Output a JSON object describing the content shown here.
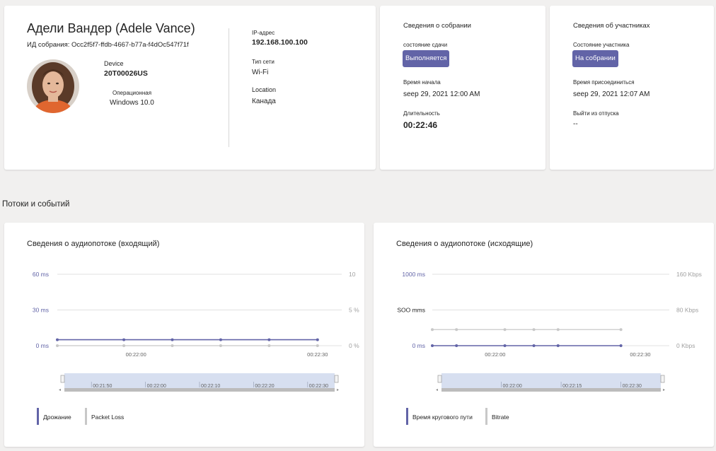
{
  "user": {
    "name": "Адели Вандер (Adele Vance)",
    "meeting_id": "ИД собрания: Occ2f5f7-ffdb-4667-b77a-f4dOc547f71f",
    "device_label": "Device",
    "device_value": "20T00026US",
    "os_label": "Операционная",
    "os_value": "Windows 10.0",
    "ip_label": "IP-адрес",
    "ip_value": "192.168.100.100",
    "network_label": "Тип сети",
    "network_value": "Wi-Fi",
    "location_label": "Location",
    "location_value": "Канада"
  },
  "meeting": {
    "title": "Сведения о собрании",
    "status_label": "состояние сдачи",
    "status_value": "Выполняется",
    "start_label": "Время начала",
    "start_value": "seep 29, 2021 12:00 AM",
    "duration_label": "Длительность",
    "duration_value": "00:22:46"
  },
  "participant": {
    "title": "Сведения об участниках",
    "status_label": "Состояние участника",
    "status_value": "На собрании",
    "join_label": "Время присоединиться",
    "join_value": "seep 29, 2021 12:07 AM",
    "leave_label": "Выйти из отпуска",
    "leave_value": "--"
  },
  "streams_title": "Потоки и событий",
  "colors": {
    "accent": "#6264a7",
    "secondary_series": "#c8c8c8",
    "range_fill": "#d7dff0"
  },
  "chart_data": [
    {
      "type": "line",
      "title": "Сведения о аудиопотоке (входящий)",
      "x": [
        "00:21:47",
        "00:21:58",
        "00:22:06",
        "00:22:14",
        "00:22:22",
        "00:22:30"
      ],
      "x_ticks": [
        "00:22:00",
        "00:22:30"
      ],
      "y_left_ticks": [
        "60 ms",
        "30 ms",
        "0 ms"
      ],
      "y_right_ticks": [
        "10",
        "5 %",
        "0 %"
      ],
      "ylim_left": [
        0,
        60
      ],
      "ylim_right": [
        0,
        10
      ],
      "series": [
        {
          "name": "Дрожание",
          "axis": "left",
          "values": [
            5,
            5,
            5,
            5,
            5,
            5
          ]
        },
        {
          "name": "Packet Loss",
          "axis": "right",
          "values": [
            0,
            0,
            0,
            0,
            0,
            0
          ]
        }
      ],
      "navigator_ticks": [
        "00:21:50",
        "00:22:00",
        "00:22:10",
        "00:22:20",
        "00:22:30"
      ],
      "grid": true,
      "legend": "bottom-left"
    },
    {
      "type": "line",
      "title": "Сведения о аудиопотоке (исходящие)",
      "x": [
        "00:21:47",
        "00:21:52",
        "00:22:02",
        "00:22:08",
        "00:22:13",
        "00:22:26"
      ],
      "x_ticks": [
        "00:22:00",
        "00:22:30"
      ],
      "y_left_ticks": [
        "1000 ms",
        "SOO mms",
        "0 ms"
      ],
      "y_right_ticks": [
        "160 Kbps",
        "80 Kbps",
        "0 Kbps"
      ],
      "ylim_left": [
        0,
        1000
      ],
      "ylim_right": [
        0,
        160
      ],
      "series": [
        {
          "name": "Время кругового пути",
          "axis": "left",
          "values": [
            0,
            0,
            0,
            0,
            0,
            0
          ]
        },
        {
          "name": "Bitrate",
          "axis": "right",
          "values": [
            36,
            36,
            36,
            36,
            36,
            36
          ]
        }
      ],
      "navigator_ticks": [
        "00:22:00",
        "00:22:15",
        "00:22:30"
      ],
      "grid": true,
      "legend": "bottom-left"
    }
  ]
}
